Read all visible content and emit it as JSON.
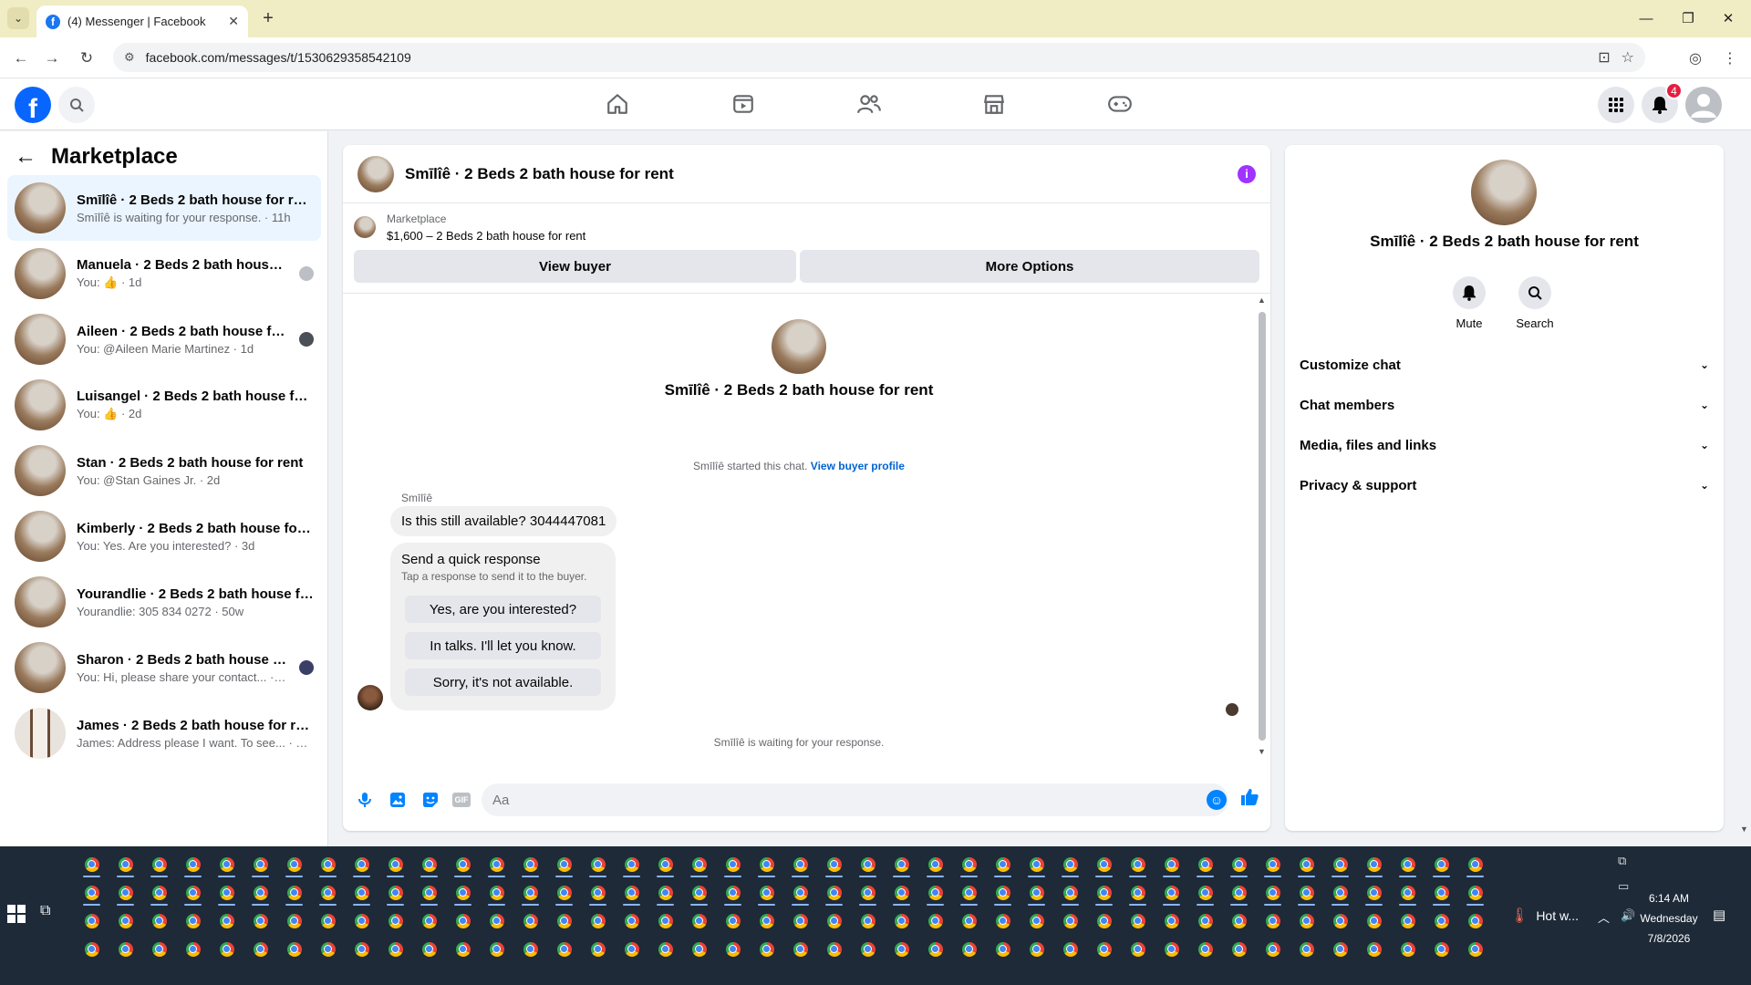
{
  "browser": {
    "tab_title": "(4) Messenger | Facebook",
    "tab_close": "✕",
    "new_tab": "+",
    "url": "facebook.com/messages/t/1530629358542109",
    "window_controls": [
      "—",
      "❐",
      "✕"
    ]
  },
  "fb_header": {
    "logo_letter": "f",
    "notification_count": "4"
  },
  "sidebar": {
    "title": "Marketplace",
    "conversations": [
      {
        "name": "Smīlîê · 2 Beds 2 bath house for rent",
        "preview": "Smīlîê is waiting for your response. · 11h",
        "active": true
      },
      {
        "name": "Manuela · 2 Beds 2 bath house for rent",
        "preview": "You: 👍 · 1d"
      },
      {
        "name": "Aileen · 2 Beds 2 bath house for rent",
        "preview": "You: @Aileen Marie Martinez · 1d"
      },
      {
        "name": "Luisangel · 2 Beds 2 bath house for rent",
        "preview": "You: 👍 · 2d"
      },
      {
        "name": "Stan · 2 Beds 2 bath house for rent",
        "preview": "You: @Stan Gaines Jr. · 2d"
      },
      {
        "name": "Kimberly · 2 Beds 2 bath house for rent",
        "preview": "You: Yes. Are you interested? · 3d"
      },
      {
        "name": "Yourandlie · 2 Beds 2 bath house for rent",
        "preview": "Yourandlie: 305 834 0272 · 50w"
      },
      {
        "name": "Sharon · 2 Beds 2 bath house for rent",
        "preview": "You: Hi, please share your contact... · 50w"
      },
      {
        "name": "James · 2 Beds 2 bath house for rent",
        "preview": "James: Address please I want. To see... · 50w"
      }
    ]
  },
  "chat": {
    "title": "Smīlîê · 2 Beds 2 bath house for rent",
    "listing_source": "Marketplace",
    "listing_detail": "$1,600 – 2 Beds 2 bath house for rent",
    "view_buyer_label": "View buyer",
    "more_options_label": "More Options",
    "intro_name": "Smīlîê · 2 Beds 2 bath house for rent",
    "started_text": "Smīlîê started this chat.",
    "view_buyer_profile": "View buyer profile",
    "sender_name": "Smīlîê",
    "message": "Is this still available? 3044447081",
    "quick_title": "Send a quick response",
    "quick_subtitle": "Tap a response to send it to the buyer.",
    "quick_responses": [
      "Yes, are you interested?",
      "In talks. I'll let you know.",
      "Sorry, it's not available."
    ],
    "waiting_text": "Smīlîê is waiting for your response.",
    "input_placeholder": "Aa",
    "gif_label": "GIF"
  },
  "info_panel": {
    "name": "Smīlîê · 2 Beds 2 bath house for rent",
    "actions": [
      {
        "label": "Mute"
      },
      {
        "label": "Search"
      }
    ],
    "sections": [
      "Customize chat",
      "Chat members",
      "Media, files and links",
      "Privacy & support"
    ]
  },
  "taskbar": {
    "weather": "Hot w...",
    "time": "6:14 AM",
    "day": "Wednesday",
    "date": "7/8/2026"
  }
}
